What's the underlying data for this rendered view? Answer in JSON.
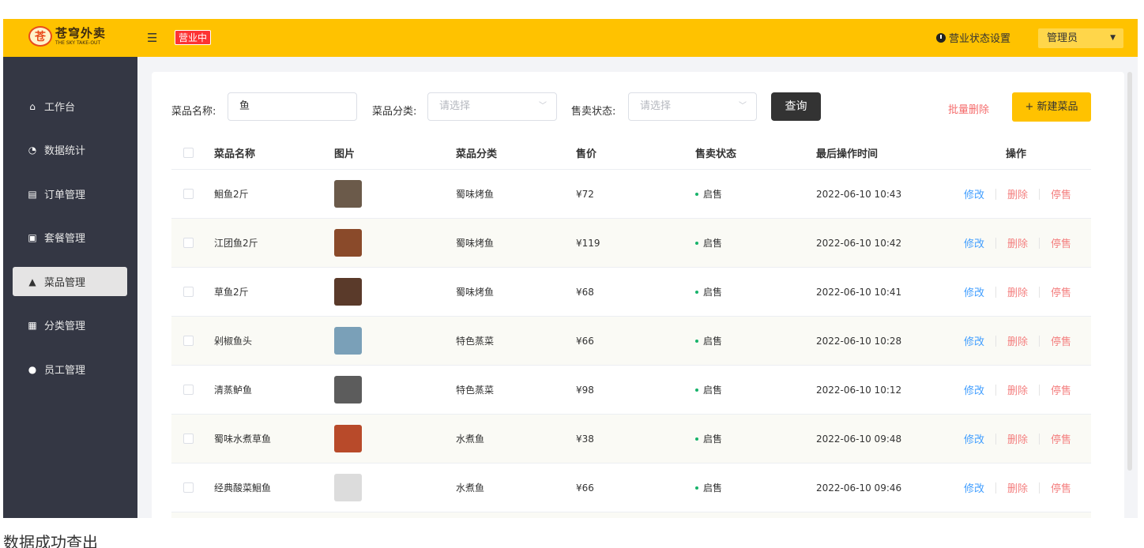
{
  "header": {
    "logo_cn": "苍穹外卖",
    "logo_en": "THE SKY TAKE-OUT",
    "menu_toggle_glyph": "☰",
    "status_tag": "营业中",
    "shop_status_setting": "营业状态设置",
    "user": "管理员"
  },
  "sidebar": {
    "items": [
      {
        "label": "工作台",
        "icon": "home-icon",
        "glyph": "⌂"
      },
      {
        "label": "数据统计",
        "icon": "chart-icon",
        "glyph": "◔"
      },
      {
        "label": "订单管理",
        "icon": "clipboard-icon",
        "glyph": "▤"
      },
      {
        "label": "套餐管理",
        "icon": "gift-icon",
        "glyph": "▣"
      },
      {
        "label": "菜品管理",
        "icon": "cloche-icon",
        "glyph": "▲"
      },
      {
        "label": "分类管理",
        "icon": "grid-icon",
        "glyph": "▦"
      },
      {
        "label": "员工管理",
        "icon": "employee-icon",
        "glyph": "●"
      }
    ]
  },
  "filters": {
    "name_label": "菜品名称:",
    "name_value": "鱼",
    "category_label": "菜品分类:",
    "category_placeholder": "请选择",
    "status_label": "售卖状态:",
    "status_placeholder": "请选择",
    "query_button": "查询",
    "batch_delete": "批量删除",
    "new_button": "+ 新建菜品"
  },
  "table": {
    "headers": {
      "name": "菜品名称",
      "image": "图片",
      "category": "菜品分类",
      "price": "售价",
      "status": "售卖状态",
      "time": "最后操作时间",
      "ops": "操作"
    },
    "ops": {
      "edit": "修改",
      "delete": "删除",
      "stop": "停售"
    },
    "rows": [
      {
        "name": "鮰鱼2斤",
        "category": "蜀味烤鱼",
        "price": "¥72",
        "status": "启售",
        "time": "2022-06-10 10:43",
        "img_color": "#6b5a4a"
      },
      {
        "name": "江团鱼2斤",
        "category": "蜀味烤鱼",
        "price": "¥119",
        "status": "启售",
        "time": "2022-06-10 10:42",
        "img_color": "#8a4a2a"
      },
      {
        "name": "草鱼2斤",
        "category": "蜀味烤鱼",
        "price": "¥68",
        "status": "启售",
        "time": "2022-06-10 10:41",
        "img_color": "#5a3a2a"
      },
      {
        "name": "剁椒鱼头",
        "category": "特色蒸菜",
        "price": "¥66",
        "status": "启售",
        "time": "2022-06-10 10:28",
        "img_color": "#7aa0b8"
      },
      {
        "name": "清蒸鲈鱼",
        "category": "特色蒸菜",
        "price": "¥98",
        "status": "启售",
        "time": "2022-06-10 10:12",
        "img_color": "#5c5c5c"
      },
      {
        "name": "蜀味水煮草鱼",
        "category": "水煮鱼",
        "price": "¥38",
        "status": "启售",
        "time": "2022-06-10 09:48",
        "img_color": "#b84a2a"
      },
      {
        "name": "经典酸菜鮰鱼",
        "category": "水煮鱼",
        "price": "¥66",
        "status": "启售",
        "time": "2022-06-10 09:46",
        "img_color": "#dcdcdc"
      }
    ]
  },
  "toast": "数据成功查出"
}
